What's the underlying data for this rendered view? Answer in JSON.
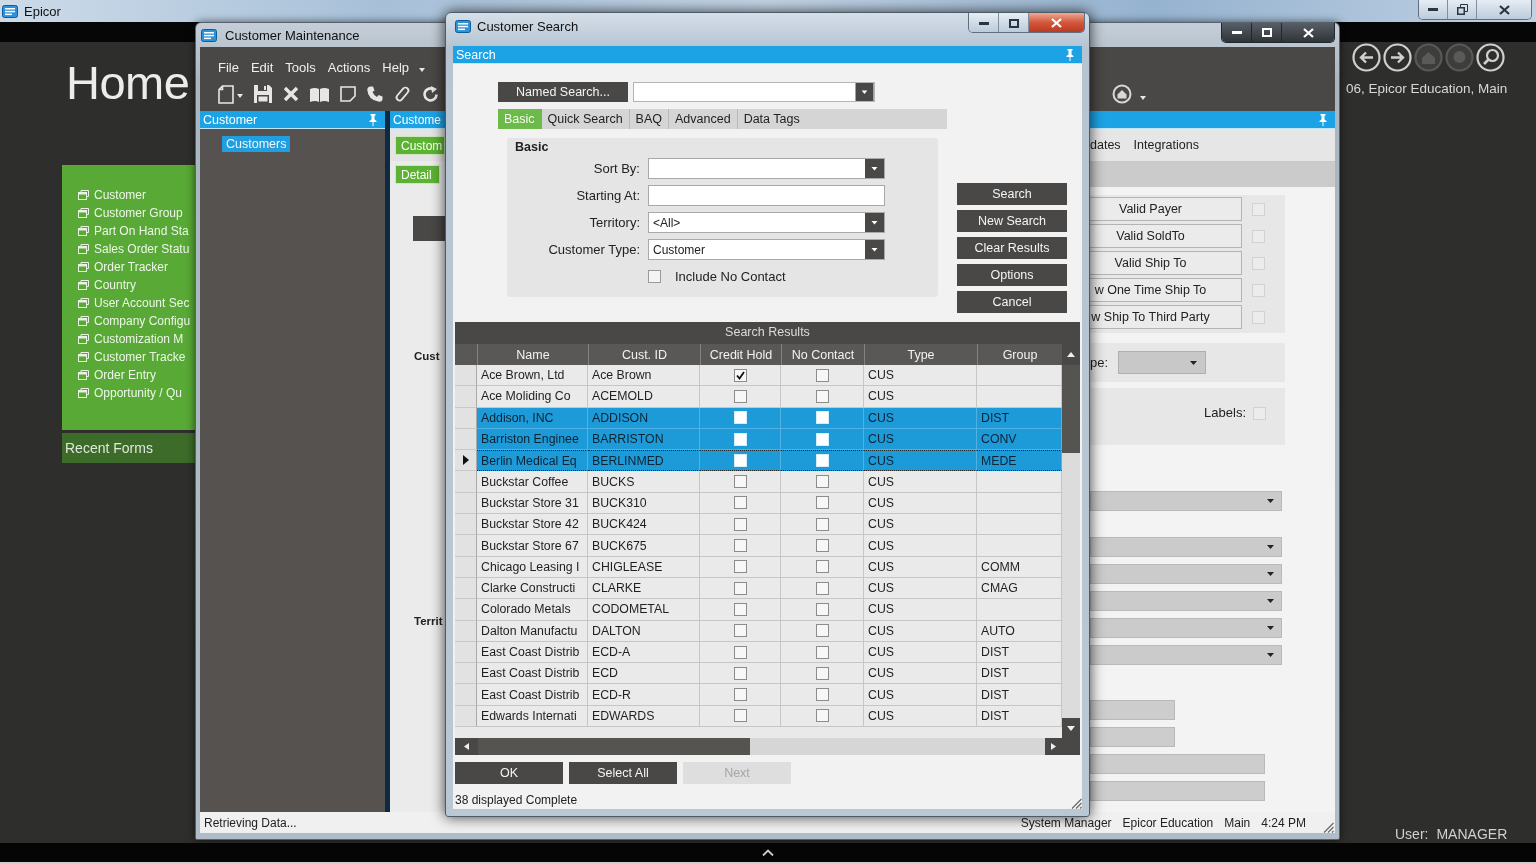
{
  "app_bar": {
    "title": "Epicor"
  },
  "home": {
    "title": "Home",
    "shortcuts": [
      "Customer",
      "Customer Group",
      "Part On Hand Sta",
      "Sales Order Statu",
      "Order Tracker",
      "Country",
      "User Account Sec",
      "Company Configu",
      "Customization M",
      "Customer Tracke",
      "Order Entry",
      "Opportunity / Qu"
    ],
    "recent_forms": "Recent Forms",
    "company": "06, Epicor Education, Main",
    "user_label": "User:",
    "user": "MANAGER"
  },
  "maintenance": {
    "title": "Customer Maintenance",
    "menu": [
      "File",
      "Edit",
      "Tools",
      "Actions",
      "Help"
    ],
    "tree": {
      "title": "Customer",
      "items": [
        {
          "label": "Customers",
          "selected": true
        }
      ]
    },
    "left_strip": {
      "header": "Custome",
      "tab": {
        "label": "Custom",
        "selected": true
      },
      "subtab": {
        "label": "Detail",
        "selected": true
      },
      "labels": [
        "Cust",
        "Territ"
      ]
    },
    "right_strip": {
      "tabs": [
        {
          "label": "dates",
          "selected": false
        },
        {
          "label": "Integrations",
          "selected": false
        }
      ],
      "options": [
        {
          "label": "Valid Payer",
          "checked": false
        },
        {
          "label": "Valid SoldTo",
          "checked": false
        },
        {
          "label": "Valid Ship To",
          "checked": false
        },
        {
          "label": "w One Time Ship To",
          "checked": false
        },
        {
          "label": "w Ship To Third Party",
          "checked": false
        }
      ],
      "type_label": "pe:",
      "labels_option": {
        "label": "Labels:",
        "checked": false
      },
      "fields": [
        {
          "kind": "dropdown"
        },
        {
          "kind": "dropdown"
        },
        {
          "kind": "dropdown"
        },
        {
          "kind": "dropdown"
        },
        {
          "kind": "dropdown"
        },
        {
          "kind": "dropdown"
        },
        {
          "kind": "textbox"
        },
        {
          "kind": "textbox"
        },
        {
          "kind": "widebox"
        },
        {
          "kind": "widebox"
        }
      ]
    },
    "status_bar": {
      "message": "Retrieving Data...",
      "items": [
        "System Manager",
        "Epicor Education",
        "Main",
        "4:24 PM"
      ]
    }
  },
  "search": {
    "title": "Customer Search",
    "panel_title": "Search",
    "named_search": "Named Search...",
    "tabs": [
      {
        "label": "Basic",
        "selected": true
      },
      {
        "label": "Quick Search",
        "selected": false
      },
      {
        "label": "BAQ",
        "selected": false
      },
      {
        "label": "Advanced",
        "selected": false
      },
      {
        "label": "Data Tags",
        "selected": false
      }
    ],
    "group_title": "Basic",
    "fields": [
      {
        "label": "Sort By:",
        "kind": "dropdown"
      },
      {
        "label": "Starting At:",
        "kind": "text"
      },
      {
        "label": "Territory:",
        "kind": "dropdown",
        "value": "<All>"
      },
      {
        "label": "Customer Type:",
        "kind": "dropdown",
        "value": "Customer"
      }
    ],
    "include_no_contact": {
      "label": "Include No Contact",
      "checked": false
    },
    "actions": [
      "Search",
      "New Search",
      "Clear Results",
      "Options",
      "Cancel"
    ],
    "results": {
      "title": "Search Results",
      "columns": [
        "Name",
        "Cust. ID",
        "Credit Hold",
        "No Contact",
        "Type",
        "Group"
      ],
      "rows": [
        {
          "name": "Ace Brown, Ltd",
          "cust_id": "Ace Brown",
          "credit_hold": true,
          "no_contact": false,
          "type": "CUS",
          "selected": false,
          "current": false
        },
        {
          "name": "Ace Moliding Co",
          "cust_id": "ACEMOLD",
          "credit_hold": false,
          "no_contact": false,
          "type": "CUS",
          "selected": false,
          "current": false
        },
        {
          "name": "Addison, INC",
          "cust_id": "ADDISON",
          "credit_hold": false,
          "no_contact": false,
          "type": "CUS",
          "group": "DIST",
          "selected": true,
          "current": false
        },
        {
          "name": "Barriston Enginee",
          "cust_id": "BARRISTON",
          "credit_hold": false,
          "no_contact": false,
          "type": "CUS",
          "group": "CONV",
          "selected": true,
          "current": false
        },
        {
          "name": "Berlin Medical Eq",
          "cust_id": "BERLINMED",
          "credit_hold": false,
          "no_contact": false,
          "type": "CUS",
          "group": "MEDE",
          "selected": true,
          "current": true
        },
        {
          "name": "Buckstar Coffee",
          "cust_id": "BUCKS",
          "credit_hold": false,
          "no_contact": false,
          "type": "CUS",
          "selected": false,
          "current": false
        },
        {
          "name": "Buckstar Store 31",
          "cust_id": "BUCK310",
          "credit_hold": false,
          "no_contact": false,
          "type": "CUS",
          "selected": false,
          "current": false
        },
        {
          "name": "Buckstar Store 42",
          "cust_id": "BUCK424",
          "credit_hold": false,
          "no_contact": false,
          "type": "CUS",
          "selected": false,
          "current": false
        },
        {
          "name": "Buckstar Store 67",
          "cust_id": "BUCK675",
          "credit_hold": false,
          "no_contact": false,
          "type": "CUS",
          "selected": false,
          "current": false
        },
        {
          "name": "Chicago Leasing I",
          "cust_id": "CHIGLEASE",
          "credit_hold": false,
          "no_contact": false,
          "type": "CUS",
          "group": "COMM",
          "selected": false,
          "current": false
        },
        {
          "name": "Clarke Constructi",
          "cust_id": "CLARKE",
          "credit_hold": false,
          "no_contact": false,
          "type": "CUS",
          "group": "CMAG",
          "selected": false,
          "current": false
        },
        {
          "name": "Colorado Metals",
          "cust_id": "CODOMETAL",
          "credit_hold": false,
          "no_contact": false,
          "type": "CUS",
          "selected": false,
          "current": false
        },
        {
          "name": "Dalton Manufactu",
          "cust_id": "DALTON",
          "credit_hold": false,
          "no_contact": false,
          "type": "CUS",
          "group": "AUTO",
          "selected": false,
          "current": false
        },
        {
          "name": "East Coast Distrib",
          "cust_id": "ECD-A",
          "credit_hold": false,
          "no_contact": false,
          "type": "CUS",
          "group": "DIST",
          "selected": false,
          "current": false
        },
        {
          "name": "East Coast Distrib",
          "cust_id": "ECD",
          "credit_hold": false,
          "no_contact": false,
          "type": "CUS",
          "group": "DIST",
          "selected": false,
          "current": false
        },
        {
          "name": "East Coast Distrib",
          "cust_id": "ECD-R",
          "credit_hold": false,
          "no_contact": false,
          "type": "CUS",
          "group": "DIST",
          "selected": false,
          "current": false
        },
        {
          "name": "Edwards Internati",
          "cust_id": "EDWARDS",
          "credit_hold": false,
          "no_contact": false,
          "type": "CUS",
          "group": "DIST",
          "selected": false,
          "current": false
        }
      ]
    },
    "footer_buttons": [
      {
        "label": "OK",
        "disabled": false
      },
      {
        "label": "Select All",
        "disabled": false
      },
      {
        "label": "Next",
        "disabled": true
      }
    ],
    "status": "38 displayed Complete"
  }
}
